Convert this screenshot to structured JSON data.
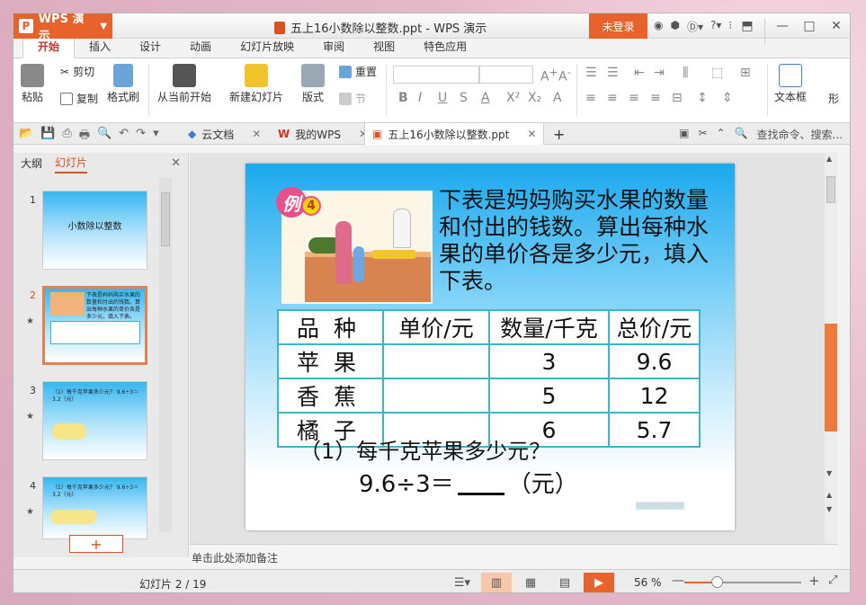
{
  "app": {
    "brand": "WPS 演示",
    "brand_logo": "P",
    "title": "五上16小数除以整数.ppt - WPS 演示",
    "login": "未登录"
  },
  "ribbon_tabs": [
    "开始",
    "插入",
    "设计",
    "动画",
    "幻灯片放映",
    "审阅",
    "视图",
    "特色应用"
  ],
  "ribbon": {
    "paste": "粘贴",
    "cut": "剪切",
    "copy": "复制",
    "format_painter": "格式刷",
    "from_current": "从当前开始",
    "new_slide": "新建幻灯片",
    "layout": "版式",
    "reset": "重置",
    "section": "节",
    "textbox": "文本框",
    "shape": "形"
  },
  "doc_tabs": [
    {
      "label": "云文档"
    },
    {
      "label": "我的WPS"
    },
    {
      "label": "五上16小数除以整数.ppt"
    }
  ],
  "search_placeholder": "查找命令、搜索...",
  "left_panel": {
    "tab_outline": "大纲",
    "tab_slides": "幻灯片",
    "thumbs": [
      {
        "num": "1",
        "title": "小数除以整数"
      },
      {
        "num": "2",
        "text": "下表是妈妈购买水果的数量和付出的钱数。算出每种水果的单价各是多少元，填入下表。"
      },
      {
        "num": "3",
        "text": "（1）每千克苹果多少元？ 9.6÷3＝3.2（元）"
      },
      {
        "num": "4",
        "text": "（1）每千克苹果多少元？ 9.6÷3＝3.2（元）"
      }
    ],
    "add_slide": "+"
  },
  "slide": {
    "badge_text": "例",
    "badge_num": "4",
    "problem": "下表是妈妈购买水果的数量和付出的钱数。算出每种水果的单价各是多少元，填入下表。",
    "table": {
      "headers": [
        "品 种",
        "单价/元",
        "数量/千克",
        "总价/元"
      ],
      "rows": [
        [
          "苹 果",
          "",
          "3",
          "9.6"
        ],
        [
          "香 蕉",
          "",
          "5",
          "12"
        ],
        [
          "橘 子",
          "",
          "6",
          "5.7"
        ]
      ]
    },
    "question": "（1）每千克苹果多少元？",
    "equation_left": "9.6÷3＝",
    "equation_right": "（元）"
  },
  "notes_placeholder": "单击此处添加备注",
  "status": {
    "page": "幻灯片 2 / 19",
    "zoom": "56 %",
    "zoom_level": 0.28
  }
}
